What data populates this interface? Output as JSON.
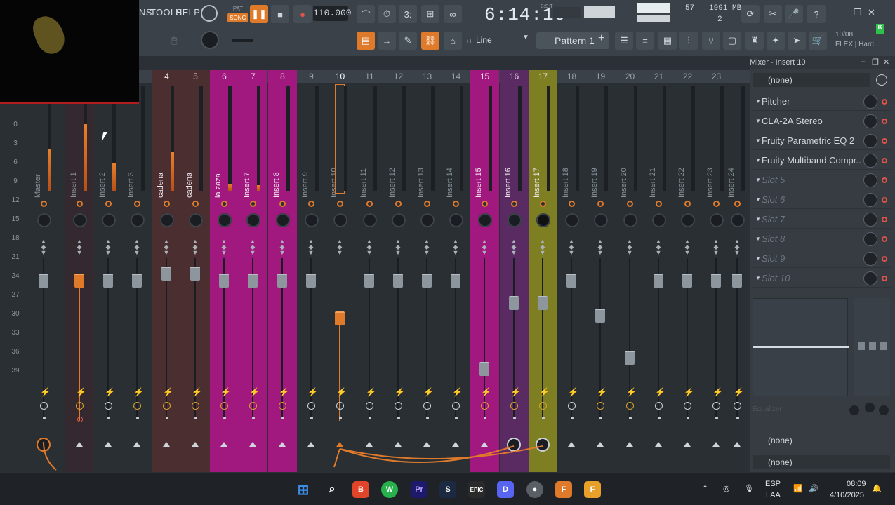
{
  "menu": {
    "items": [
      "NS",
      "TOOLS",
      "HELP"
    ]
  },
  "transport": {
    "pat": "PAT",
    "song": "SONG",
    "tempo": "110.000"
  },
  "clock": {
    "time": "6:14:10",
    "unit": "B:S:T"
  },
  "perf": {
    "cpu": "57",
    "mem": "1991 MB",
    "voices": "2"
  },
  "toolbar2": {
    "snap": "Line",
    "pattern": "Pattern 1",
    "plus": "+"
  },
  "hint": {
    "date": "10/08",
    "title": "FLEX | Hard..."
  },
  "header_numbers": [
    "4",
    "5",
    "6",
    "7",
    "8",
    "9",
    "10",
    "11",
    "12",
    "13",
    "14",
    "15",
    "16",
    "17",
    "18",
    "19",
    "20",
    "21",
    "22",
    "23"
  ],
  "db_scale": [
    "0",
    "3",
    "6",
    "9",
    "12",
    "15",
    "18",
    "21",
    "24",
    "27",
    "30",
    "33",
    "36",
    "39"
  ],
  "channels": [
    {
      "name": "Master"
    },
    {
      "name": "Insert 1"
    },
    {
      "name": "Insert 2"
    },
    {
      "name": "Insert 3"
    },
    {
      "name": "cadena"
    },
    {
      "name": "cadena"
    },
    {
      "name": "la zaza"
    },
    {
      "name": "Insert 7"
    },
    {
      "name": "Insert 8"
    },
    {
      "name": "Insert 9"
    },
    {
      "name": "Insert 10"
    },
    {
      "name": "Insert 11"
    },
    {
      "name": "Insert 12"
    },
    {
      "name": "Insert 13"
    },
    {
      "name": "Insert 14"
    },
    {
      "name": "Insert 15"
    },
    {
      "name": "Insert 16"
    },
    {
      "name": "Insert 17"
    },
    {
      "name": "Insert 18"
    },
    {
      "name": "Insert 19"
    },
    {
      "name": "Insert 20"
    },
    {
      "name": "Insert 21"
    },
    {
      "name": "Insert 22"
    },
    {
      "name": "Insert 23"
    },
    {
      "name": "Insert 24"
    }
  ],
  "panel": {
    "title": "Mixer - Insert 10",
    "preset": "(none)",
    "slots": [
      "Pitcher",
      "CLA-2A Stereo",
      "Fruity Parametric EQ 2",
      "Fruity Multiband Compr...",
      "Slot 5",
      "Slot 6",
      "Slot 7",
      "Slot 8",
      "Slot 9",
      "Slot 10"
    ],
    "eq_label": "Equalizer",
    "in_route": "(none)",
    "out_route": "(none)"
  },
  "taskbar": {
    "lang": "ESP",
    "lang2": "LAA",
    "time": "08:09",
    "date": "4/10/2025"
  },
  "colors": {
    "accent": "#e07a2b",
    "purple": "#a1187f",
    "pink": "#c72f9e",
    "olive": "#7d7f22",
    "brown": "#4a2e30",
    "violet": "#5a2a63"
  }
}
